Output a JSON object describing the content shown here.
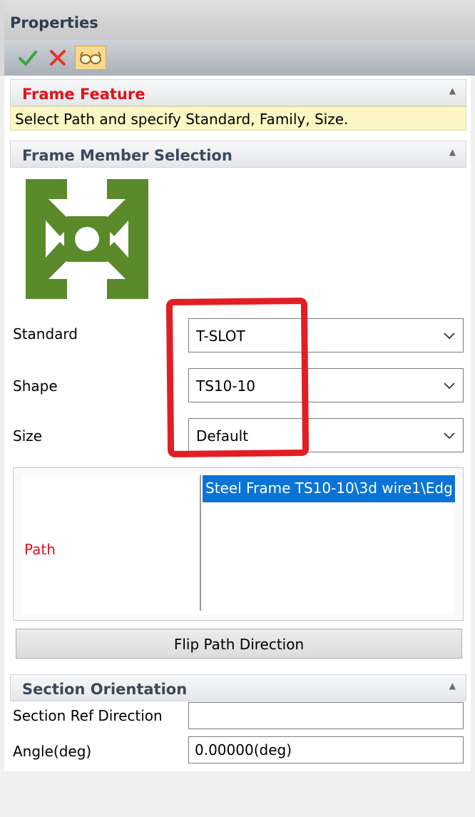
{
  "panel": {
    "title": "Properties"
  },
  "toolbar": {
    "ok_icon": "checkmark-icon",
    "cancel_icon": "cross-icon",
    "preview_icon": "glasses-icon"
  },
  "frame_feature": {
    "header": "Frame Feature",
    "hint": "Select Path and specify Standard, Family, Size."
  },
  "member_selection": {
    "header": "Frame Member Selection",
    "icon": "t-slot-profile-icon",
    "standard": {
      "label": "Standard",
      "value": "T-SLOT"
    },
    "shape": {
      "label": "Shape",
      "value": "TS10-10"
    },
    "size": {
      "label": "Size",
      "value": "Default"
    },
    "path": {
      "label": "Path",
      "items": [
        "Steel Frame TS10-10\\3d wire1\\Edg"
      ]
    },
    "flip_button": "Flip Path Direction"
  },
  "section_orientation": {
    "header": "Section Orientation",
    "ref_direction": {
      "label": "Section Ref Direction",
      "value": ""
    },
    "angle": {
      "label": "Angle(deg)",
      "value": "0.00000(deg)"
    }
  },
  "colors": {
    "accent_red": "#e3101b",
    "icon_green": "#5a8a2a",
    "selection_blue": "#0a74d6"
  }
}
